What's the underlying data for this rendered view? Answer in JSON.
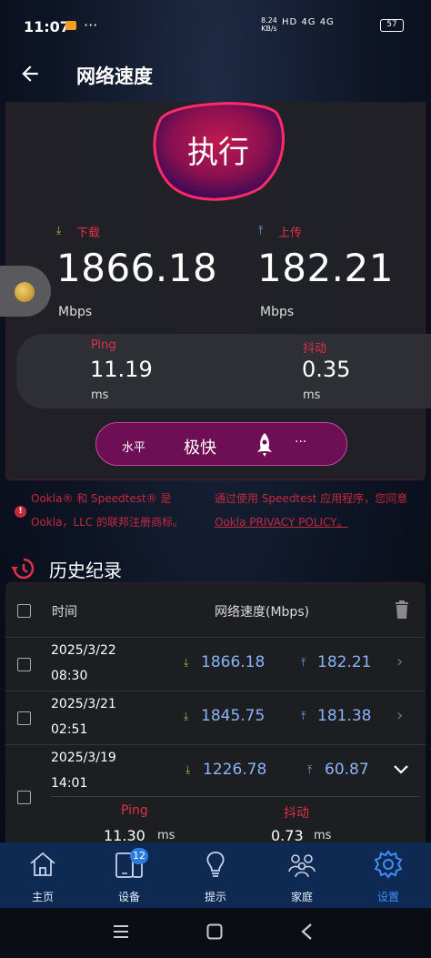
{
  "status_bar": {
    "time": "11:07",
    "dots": "···",
    "net_speed_value": "8.24",
    "net_speed_unit": "KB/s",
    "signal_text": "HD 4G 4G",
    "battery": "57"
  },
  "appbar": {
    "title": "网络速度"
  },
  "speedtest": {
    "run_label": "执行",
    "download_label": "下载",
    "download_value": "1866.18",
    "download_unit": "Mbps",
    "upload_label": "上传",
    "upload_value": "182.21",
    "upload_unit": "Mbps",
    "ping_label": "Ping",
    "ping_value": "11.19",
    "ping_unit": "ms",
    "jitter_label": "抖动",
    "jitter_value": "0.35",
    "jitter_unit": "ms",
    "level_key": "水平",
    "level_value": "极快",
    "more": "···"
  },
  "notice": {
    "left_line1": "Ookla® 和 Speedtest® 是",
    "left_line2": "Ookla，LLC 的联邦注册商标。",
    "right_line1": "通过使用 Speedtest 应用程序，您同意",
    "right_line2": "Ookla PRIVACY POLICY。"
  },
  "history": {
    "title": "历史纪录",
    "col_time": "时间",
    "col_speed": "网络速度(Mbps)",
    "rows": [
      {
        "date": "2025/3/22",
        "time": "08:30",
        "down": "1866.18",
        "up": "182.21"
      },
      {
        "date": "2025/3/21",
        "time": "02:51",
        "down": "1845.75",
        "up": "181.38"
      },
      {
        "date": "2025/3/19",
        "time": "14:01",
        "down": "1226.78",
        "up": "60.87"
      }
    ],
    "expanded": {
      "ping_label": "Ping",
      "ping_value": "11.30",
      "ping_unit": "ms",
      "jitter_label": "抖动",
      "jitter_value": "0.73",
      "jitter_unit": "ms"
    }
  },
  "bottom_nav": {
    "items": [
      {
        "label": "主页",
        "icon": "home-icon"
      },
      {
        "label": "设备",
        "icon": "devices-icon",
        "badge": "12"
      },
      {
        "label": "提示",
        "icon": "lightbulb-icon"
      },
      {
        "label": "家庭",
        "icon": "family-icon"
      },
      {
        "label": "设置",
        "icon": "gear-icon",
        "active": true
      }
    ]
  },
  "colors": {
    "accent_red": "#e0304a",
    "accent_blue": "#8ab4f8",
    "nav_active": "#3f8fff",
    "pill_bg": "#6e0f55"
  }
}
